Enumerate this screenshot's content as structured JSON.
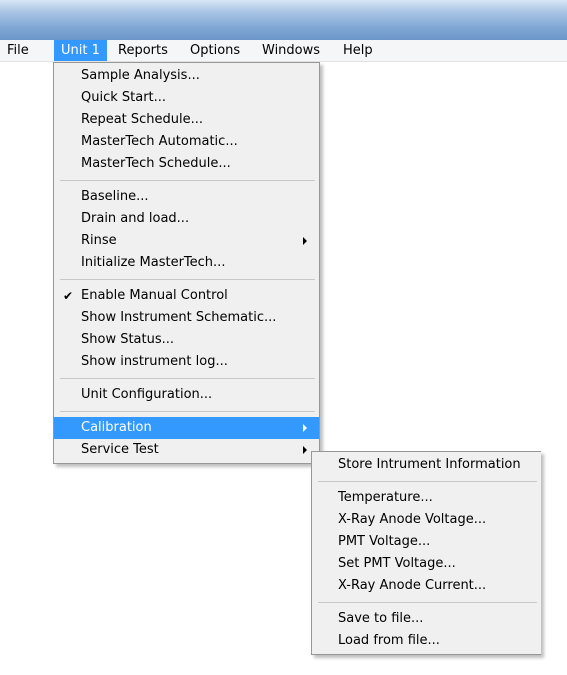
{
  "menubar": {
    "items": [
      "File",
      "Unit 1",
      "Reports",
      "Options",
      "Windows",
      "Help"
    ]
  },
  "unit_menu": {
    "group1": [
      "Sample Analysis...",
      "Quick Start...",
      "Repeat Schedule...",
      "MasterTech Automatic...",
      "MasterTech Schedule..."
    ],
    "group2": [
      "Baseline...",
      "Drain and load...",
      "Rinse",
      "Initialize MasterTech..."
    ],
    "group3": [
      "Enable Manual Control",
      "Show Instrument Schematic...",
      "Show Status...",
      "Show instrument log..."
    ],
    "group4": [
      "Unit Configuration..."
    ],
    "group5": [
      "Calibration",
      "Service Test"
    ],
    "checked_item": "Enable Manual Control",
    "highlighted_item": "Calibration"
  },
  "calibration_menu": {
    "group1": [
      "Store Intrument Information"
    ],
    "group2": [
      "Temperature...",
      "X-Ray Anode Voltage...",
      "PMT Voltage...",
      "Set PMT Voltage...",
      "X-Ray Anode Current..."
    ],
    "group3": [
      "Save to file...",
      "Load from file..."
    ]
  },
  "colors": {
    "highlight": "#3399ff",
    "menu_bg": "#f0f0f0",
    "title_gradient_dark": "#6d96c9"
  },
  "icons": {
    "check": "check-icon",
    "submenu_arrow": "submenu-arrow-icon"
  }
}
